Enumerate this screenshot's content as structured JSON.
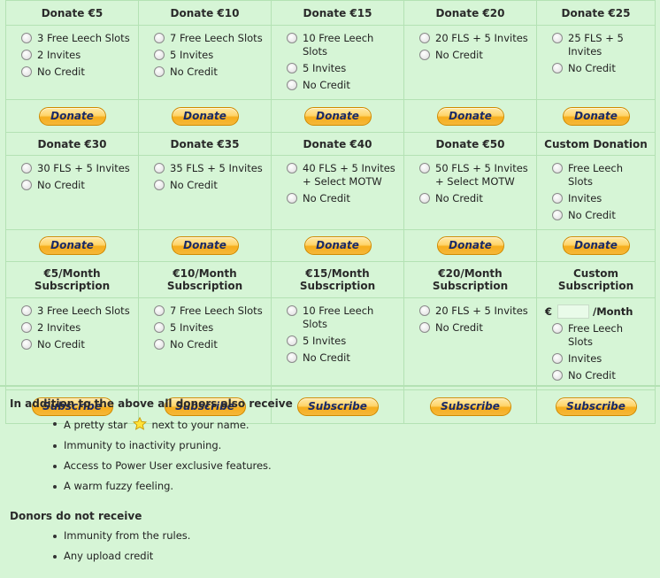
{
  "buttons": {
    "donate": "Donate",
    "subscribe": "Subscribe"
  },
  "row1": [
    {
      "title": "Donate €5",
      "options": [
        "3 Free Leech Slots",
        "2 Invites",
        "No Credit"
      ]
    },
    {
      "title": "Donate €10",
      "options": [
        "7 Free Leech Slots",
        "5 Invites",
        "No Credit"
      ]
    },
    {
      "title": "Donate €15",
      "options": [
        "10 Free Leech Slots",
        "5 Invites",
        "No Credit"
      ]
    },
    {
      "title": "Donate €20",
      "options": [
        "20 FLS + 5 Invites",
        "No Credit"
      ]
    },
    {
      "title": "Donate €25",
      "options": [
        "25 FLS + 5 Invites",
        "No Credit"
      ]
    }
  ],
  "row2": [
    {
      "title": "Donate €30",
      "options": [
        "30 FLS + 5 Invites",
        "No Credit"
      ]
    },
    {
      "title": "Donate €35",
      "options": [
        "35 FLS + 5 Invites",
        "No Credit"
      ]
    },
    {
      "title": "Donate €40",
      "options": [
        "40 FLS + 5 Invites + Select MOTW",
        "No Credit"
      ]
    },
    {
      "title": "Donate €50",
      "options": [
        "50 FLS + 5 Invites + Select MOTW",
        "No Credit"
      ]
    },
    {
      "title": "Custom Donation",
      "options": [
        "Free Leech Slots",
        "Invites",
        "No Credit"
      ]
    }
  ],
  "row3": [
    {
      "title": "€5/Month Subscription",
      "options": [
        "3 Free Leech Slots",
        "2 Invites",
        "No Credit"
      ]
    },
    {
      "title": "€10/Month Subscription",
      "options": [
        "7 Free Leech Slots",
        "5 Invites",
        "No Credit"
      ]
    },
    {
      "title": "€15/Month Subscription",
      "options": [
        "10 Free Leech Slots",
        "5 Invites",
        "No Credit"
      ]
    },
    {
      "title": "€20/Month Subscription",
      "options": [
        "20 FLS + 5 Invites",
        "No Credit"
      ]
    },
    {
      "title": "Custom Subscription",
      "currency": "€",
      "per_month": "/Month",
      "amount_value": "",
      "options": [
        "Free Leech Slots",
        "Invites",
        "No Credit"
      ]
    }
  ],
  "benefits": {
    "heading": "In addition to the above all donors also receive",
    "items": [
      {
        "before": "A pretty star",
        "after": "next to your name.",
        "icon": "star-icon"
      },
      {
        "text": "Immunity to inactivity pruning."
      },
      {
        "text": "Access to Power User exclusive features."
      },
      {
        "text": "A warm fuzzy feeling."
      }
    ]
  },
  "exclusions": {
    "heading": "Donors do not receive",
    "items": [
      "Immunity from the rules.",
      "Any upload credit"
    ]
  },
  "colors": {
    "background": "#d6f5d6",
    "border": "#b4e2b4",
    "button": "#ffd46a",
    "button_text": "#1a2a66"
  }
}
